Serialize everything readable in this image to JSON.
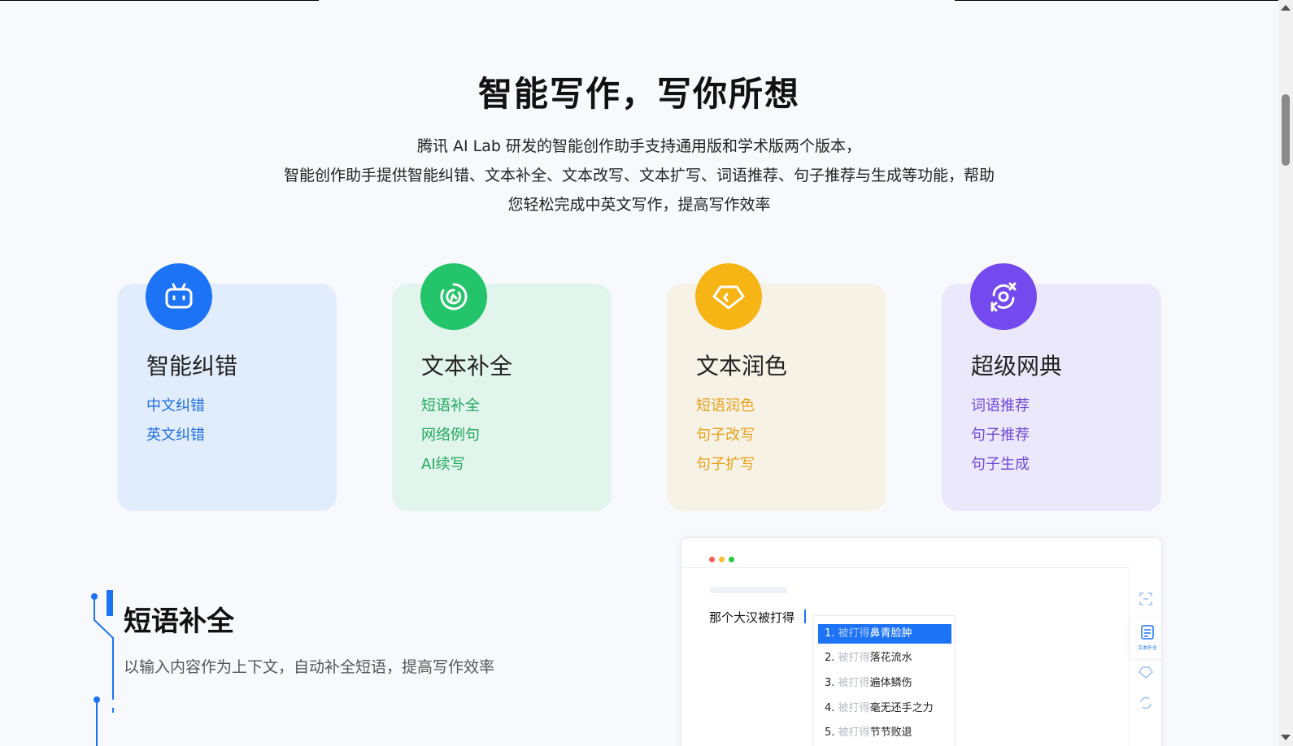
{
  "hero": {
    "title": "智能写作，写你所想",
    "desc_line1": "腾讯 AI Lab 研发的智能创作助手支持通用版和学术版两个版本，",
    "desc_line2": "智能创作助手提供智能纠错、文本补全、文本改写、文本扩写、词语推荐、句子推荐与生成等功能，帮助",
    "desc_line3": "您轻松完成中英文写作，提高写作效率"
  },
  "cards": [
    {
      "title": "智能纠错",
      "icon": "robot-icon",
      "color": "#1d73f5",
      "links": [
        "中文纠错",
        "英文纠错"
      ]
    },
    {
      "title": "文本补全",
      "icon": "refresh-chat-icon",
      "color": "#24c46b",
      "links": [
        "短语补全",
        "网络例句",
        "AI续写"
      ]
    },
    {
      "title": "文本润色",
      "icon": "diamond-code-icon",
      "color": "#f6b415",
      "links": [
        "短语润色",
        "句子改写",
        "句子扩写"
      ]
    },
    {
      "title": "超级网典",
      "icon": "translate-cycle-icon",
      "color": "#7449ed",
      "links": [
        "词语推荐",
        "句子推荐",
        "句子生成"
      ]
    }
  ],
  "feature": {
    "title": "短语补全",
    "desc": "以输入内容作为上下文，自动补全短语，提高写作效率"
  },
  "demo": {
    "input_text": "那个大汉被打得",
    "side_label": "文本补全",
    "suggestions": [
      {
        "num": "1.",
        "prefix": "被打得",
        "text": "鼻青脸肿"
      },
      {
        "num": "2.",
        "prefix": "被打得",
        "text": "落花流水"
      },
      {
        "num": "3.",
        "prefix": "被打得",
        "text": "遍体鳞伤"
      },
      {
        "num": "4.",
        "prefix": "被打得",
        "text": "毫无还手之力"
      },
      {
        "num": "5.",
        "prefix": "被打得",
        "text": "节节败退"
      }
    ],
    "dot_colors": [
      "#f25f58",
      "#fbbe2e",
      "#29c940"
    ]
  },
  "colors": {
    "accent_blue": "#1d73f5",
    "background": "#f8f9fd"
  }
}
